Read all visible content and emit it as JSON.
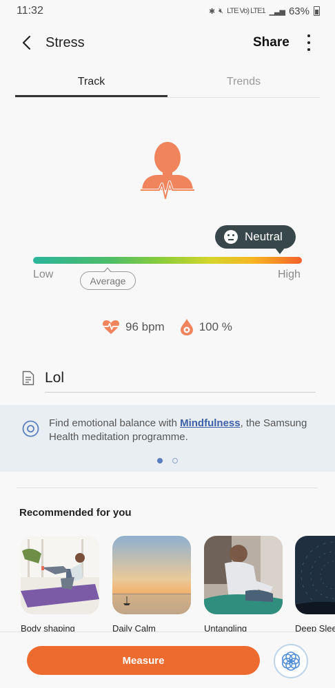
{
  "status_bar": {
    "time": "11:32",
    "network": "LTE Vo) LTE1",
    "battery": "63%"
  },
  "header": {
    "title": "Stress",
    "share_label": "Share"
  },
  "tabs": [
    {
      "label": "Track"
    },
    {
      "label": "Trends"
    }
  ],
  "stress": {
    "level_label": "Neutral",
    "low_label": "Low",
    "high_label": "High",
    "average_label": "Average",
    "level_fraction": 0.92,
    "average_fraction": 0.28
  },
  "metrics": {
    "heart_rate": "96 bpm",
    "oxygen": "100 %"
  },
  "note": {
    "text": "Lol"
  },
  "banner": {
    "text_before": "Find emotional balance with ",
    "link_text": "Mindfulness",
    "text_after": ", the Samsung Health meditation programme.",
    "page_count": 2,
    "active_page": 1
  },
  "recommended": {
    "title": "Recommended for you",
    "items": [
      {
        "label": "Body shaping"
      },
      {
        "label": "Daily Calm"
      },
      {
        "label": "Untangling"
      },
      {
        "label": "Deep Slee"
      }
    ]
  },
  "actions": {
    "measure_label": "Measure"
  },
  "colors": {
    "accent": "#ee6b2f",
    "tooltip": "#37474a",
    "link": "#3d5fa7"
  }
}
